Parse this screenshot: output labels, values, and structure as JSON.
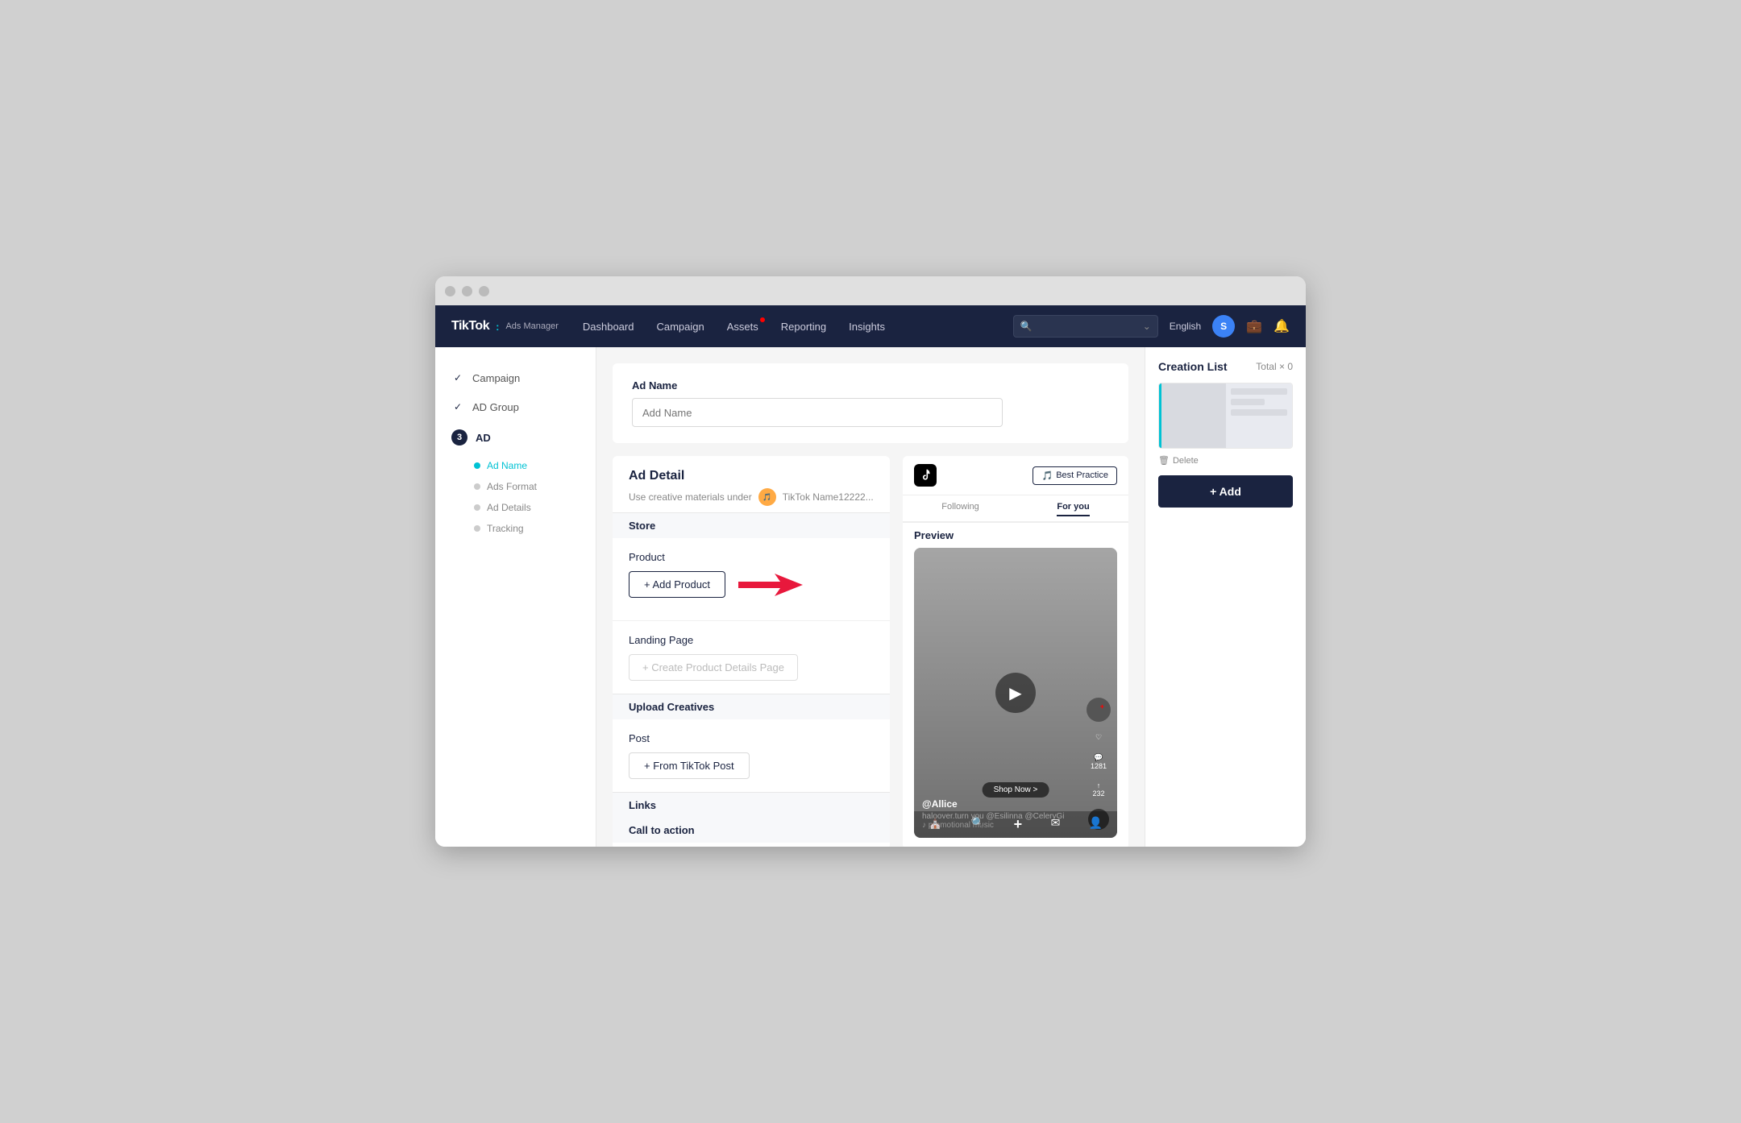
{
  "window": {
    "title": "TikTok Ads Manager"
  },
  "topnav": {
    "logo": "TikTok",
    "logo_sub": "Ads Manager",
    "links": [
      {
        "id": "dashboard",
        "label": "Dashboard",
        "badge": false
      },
      {
        "id": "campaign",
        "label": "Campaign",
        "badge": false
      },
      {
        "id": "assets",
        "label": "Assets",
        "badge": true
      },
      {
        "id": "reporting",
        "label": "Reporting",
        "badge": false
      },
      {
        "id": "insights",
        "label": "Insights",
        "badge": false
      }
    ],
    "language": "English",
    "avatar_initial": "S",
    "search_placeholder": ""
  },
  "sidebar": {
    "items": [
      {
        "id": "campaign",
        "label": "Campaign",
        "type": "checked"
      },
      {
        "id": "ad-group",
        "label": "AD Group",
        "type": "checked"
      },
      {
        "id": "ad",
        "label": "AD",
        "type": "step",
        "step": "3"
      }
    ],
    "sub_items": [
      {
        "id": "ad-name",
        "label": "Ad Name",
        "active": true
      },
      {
        "id": "ads-format",
        "label": "Ads Format",
        "active": false
      },
      {
        "id": "ad-details",
        "label": "Ad Details",
        "active": false
      },
      {
        "id": "tracking",
        "label": "Tracking",
        "active": false
      }
    ]
  },
  "ad_name": {
    "label": "Ad Name",
    "placeholder": "Add Name"
  },
  "ad_detail": {
    "title": "Ad Detail",
    "creative_label": "Use creative materials under",
    "account_name": "TikTok Name12222...",
    "sections": {
      "store": {
        "label": "Store"
      },
      "product": {
        "label": "Product",
        "add_product_label": "+ Add Product"
      },
      "landing_page": {
        "label": "Landing Page",
        "create_label": "+ Create Product Details Page"
      },
      "upload_creatives": {
        "label": "Upload Creatives"
      },
      "post": {
        "label": "Post",
        "from_tiktok": "+ From TikTok Post"
      },
      "links": {
        "label": "Links"
      },
      "call_to_action": {
        "label": "Call to action"
      }
    }
  },
  "preview": {
    "title": "Preview",
    "best_practice_label": "Best Practice",
    "tabs": [
      "Following",
      "For you"
    ],
    "active_tab": "For you",
    "user": "@Allice",
    "caption": "haloover.turn you @Esilinna @CeleryGi",
    "music": "♪ promotional music",
    "shop_now": "Shop Now >",
    "like_count": "",
    "comment_count": "1281",
    "share_count": "232"
  },
  "creation_list": {
    "title": "Creation List",
    "total_label": "Total × 0",
    "delete_label": "Delete",
    "add_label": "+ Add"
  }
}
